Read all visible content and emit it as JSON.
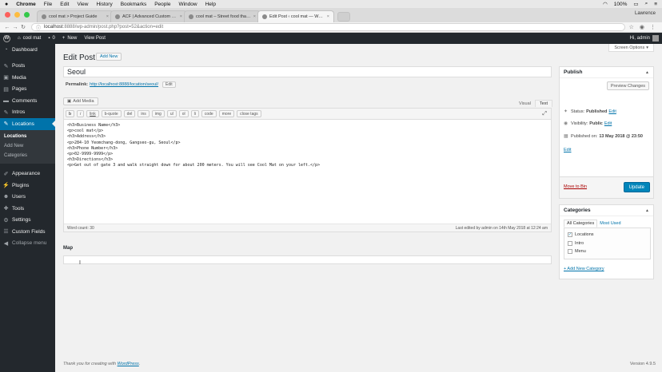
{
  "mac_menu": {
    "app": "Chrome",
    "items": [
      "File",
      "Edit",
      "View",
      "History",
      "Bookmarks",
      "People",
      "Window",
      "Help"
    ],
    "battery": "100%",
    "clock": "Lawrence"
  },
  "browser": {
    "tabs": [
      {
        "label": "cool mat > Project Guide"
      },
      {
        "label": "ACF | Advanced Custom Fields"
      },
      {
        "label": "cool mat – Street food that su"
      },
      {
        "label": "Edit Post ‹ cool mat — WordPr"
      }
    ],
    "url_host": "localhost",
    "url_rest": ":8888/wp-admin/post.php?post=52&action=edit"
  },
  "adminbar": {
    "site": "cool mat",
    "comments": "0",
    "new": "New",
    "view": "View Post",
    "greeting": "Hi, admin"
  },
  "sidebar": {
    "items": [
      {
        "label": "Dashboard",
        "icon": "dashboard-icon"
      },
      {
        "label": "Posts",
        "icon": "pin-icon"
      },
      {
        "label": "Media",
        "icon": "media-icon"
      },
      {
        "label": "Pages",
        "icon": "pages-icon"
      },
      {
        "label": "Comments",
        "icon": "comment-icon"
      },
      {
        "label": "Intros",
        "icon": "pin-icon"
      },
      {
        "label": "Locations",
        "icon": "pin-icon"
      },
      {
        "label": "Appearance",
        "icon": "brush-icon"
      },
      {
        "label": "Plugins",
        "icon": "plug-icon"
      },
      {
        "label": "Users",
        "icon": "users-icon"
      },
      {
        "label": "Tools",
        "icon": "wrench-icon"
      },
      {
        "label": "Settings",
        "icon": "settings-icon"
      },
      {
        "label": "Custom Fields",
        "icon": "fields-icon"
      },
      {
        "label": "Collapse menu",
        "icon": "collapse-icon"
      }
    ],
    "submenu": [
      "Locations",
      "Add New",
      "Categories"
    ]
  },
  "main": {
    "screen_options": "Screen Options",
    "title": "Edit Post",
    "add_new": "Add New",
    "post_title": "Seoul",
    "permalink_label": "Permalink:",
    "permalink_url": "http://localhost:8888/location/seoul/",
    "permalink_edit": "Edit",
    "add_media": "Add Media",
    "mode_visual": "Visual",
    "mode_text": "Text",
    "quicktags": [
      "b",
      "i",
      "link",
      "b-quote",
      "del",
      "ins",
      "img",
      "ul",
      "ol",
      "li",
      "code",
      "more",
      "close tags"
    ],
    "content_lines": [
      "<h3>Business Name</h3>",
      "<p>cool mat</p>",
      "<h3>Address</h3>",
      "<p>284-10 Yeomchang-dong, Gangseo-gu, Seoul</p>",
      "<h3>Phone Number</h3>",
      "<p>02-9999-9999</p>",
      "<h3>Directions</h3>",
      "<p>Get out of gate 3 and walk straight down for about 200 meters. You will see Cool Mat on your left.</p>"
    ],
    "word_count": "Word count: 30",
    "last_edited": "Last edited by admin on 14th May 2018 at 12:24 am",
    "map_label": "Map",
    "footer_text": "Thank you for creating with",
    "footer_link": "WordPress",
    "version": "Version 4.9.5"
  },
  "publish": {
    "title": "Publish",
    "preview": "Preview Changes",
    "status_label": "Status:",
    "status_value": "Published",
    "visibility_label": "Visibility:",
    "visibility_value": "Public",
    "published_label": "Published on:",
    "published_value": "13 May 2018 @ 23:50",
    "edit": "Edit",
    "trash": "Move to Bin",
    "update": "Update"
  },
  "categories": {
    "title": "Categories",
    "tab_all": "All Categories",
    "tab_used": "Most Used",
    "items": [
      {
        "label": "Locations",
        "checked": true
      },
      {
        "label": "Intro",
        "checked": false
      },
      {
        "label": "Menu",
        "checked": false
      }
    ],
    "add_new": "+ Add New Category"
  },
  "colors": {
    "accent": "#0073aa",
    "admin_dark": "#23282d",
    "update_button": "#0085ba"
  }
}
